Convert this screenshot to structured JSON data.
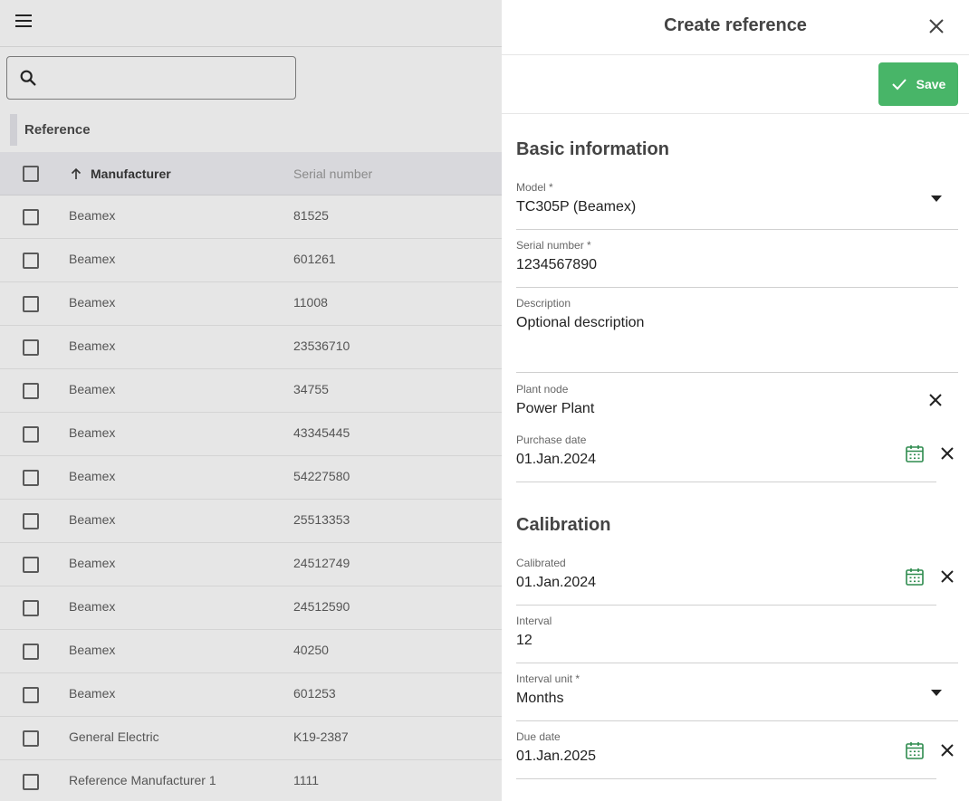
{
  "search": {
    "placeholder": ""
  },
  "section": {
    "title": "Reference"
  },
  "grid": {
    "columns": {
      "manufacturer": "Manufacturer",
      "serial": "Serial number"
    },
    "rows": [
      {
        "manufacturer": "Beamex",
        "serial": "81525"
      },
      {
        "manufacturer": "Beamex",
        "serial": "601261"
      },
      {
        "manufacturer": "Beamex",
        "serial": "11008"
      },
      {
        "manufacturer": "Beamex",
        "serial": "23536710"
      },
      {
        "manufacturer": "Beamex",
        "serial": "34755"
      },
      {
        "manufacturer": "Beamex",
        "serial": "43345445"
      },
      {
        "manufacturer": "Beamex",
        "serial": "54227580"
      },
      {
        "manufacturer": "Beamex",
        "serial": "25513353"
      },
      {
        "manufacturer": "Beamex",
        "serial": "24512749"
      },
      {
        "manufacturer": "Beamex",
        "serial": "24512590"
      },
      {
        "manufacturer": "Beamex",
        "serial": "40250"
      },
      {
        "manufacturer": "Beamex",
        "serial": "601253"
      },
      {
        "manufacturer": "General Electric",
        "serial": "K19-2387"
      },
      {
        "manufacturer": "Reference Manufacturer 1",
        "serial": "1111"
      }
    ]
  },
  "drawer": {
    "title": "Create reference",
    "save_label": "Save",
    "basic": {
      "title": "Basic information",
      "model_label": "Model *",
      "model_value": "TC305P (Beamex)",
      "serial_label": "Serial number *",
      "serial_value": "1234567890",
      "description_label": "Description",
      "description_value": "Optional description",
      "plant_label": "Plant node",
      "plant_value": "Power Plant",
      "purchase_label": "Purchase date",
      "purchase_value": "01.Jan.2024"
    },
    "calibration": {
      "title": "Calibration",
      "calibrated_label": "Calibrated",
      "calibrated_value": "01.Jan.2024",
      "interval_label": "Interval",
      "interval_value": "12",
      "unit_label": "Interval unit *",
      "unit_value": "Months",
      "due_label": "Due date",
      "due_value": "01.Jan.2025"
    }
  },
  "colors": {
    "accent": "#48b568",
    "calendar_icon": "#2e8b4e"
  },
  "icons": [
    "menu-icon",
    "search-icon",
    "sort-arrow-up-icon",
    "close-icon",
    "check-icon",
    "chevron-down-icon",
    "calendar-icon",
    "clear-icon"
  ]
}
